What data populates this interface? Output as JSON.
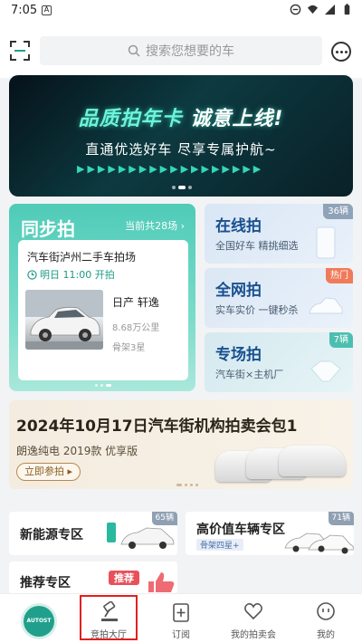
{
  "status_bar": {
    "time": "7:05",
    "notif_icon": "A",
    "icons": [
      "dnd-icon",
      "wifi-icon",
      "signal-icon",
      "battery-icon"
    ]
  },
  "header": {
    "search_placeholder": "搜索您想要的车",
    "scan_icon": "scan-icon",
    "chat_icon": "chat-icon"
  },
  "banner": {
    "title_part1": "品质拍年卡",
    "title_part2": "诚意上线!",
    "subtitle": "直通优选好车 尽享专属护航~",
    "slides": 3,
    "active_slide": 2
  },
  "sync_auction": {
    "title": "同步拍",
    "count_label": "当前共28场",
    "venue": "汽车街泸州二手车拍场",
    "time_label": "明日 11:00 开拍",
    "car_model": "日产 轩逸",
    "mileage": "8.68万公里",
    "frame_grade": "骨架3星",
    "slides": 3,
    "active_slide": 3
  },
  "right_cards": [
    {
      "title": "在线拍",
      "subtitle": "全国好车 精挑细选",
      "tag": "36辆",
      "tag_color": "#8fa3b8"
    },
    {
      "title": "全网拍",
      "subtitle": "实车实价 一键秒杀",
      "tag": "热门",
      "tag_color": "#f07a5a"
    },
    {
      "title": "专场拍",
      "subtitle": "汽车街×主机厂",
      "tag": "7辆",
      "tag_color": "#4bbfb0"
    }
  ],
  "auction_banner": {
    "title": "2024年10月17日汽车街机构拍卖会包1",
    "subtitle": "朗逸纯电 2019款 优享版",
    "button_label": "立即参拍 ▸",
    "slides": 4,
    "active_slide": 1
  },
  "zones": [
    {
      "title": "新能源专区",
      "tag": "65辆"
    },
    {
      "title": "高价值车辆专区",
      "tag": "71辆",
      "badge": "骨架四星+"
    },
    {
      "title": "推荐专区",
      "badge": "推荐"
    }
  ],
  "nav": {
    "logo_text": "AUTOST",
    "items": [
      {
        "label": "竞拍大厅",
        "icon": "gavel-icon"
      },
      {
        "label": "订阅",
        "icon": "subscribe-icon"
      },
      {
        "label": "我的拍卖会",
        "icon": "heart-icon"
      },
      {
        "label": "我的",
        "icon": "profile-icon"
      }
    ],
    "selected_index": 0
  },
  "colors": {
    "accent_teal": "#20a08c",
    "highlight_red": "#e02020",
    "card_blue_text": "#19508f"
  }
}
